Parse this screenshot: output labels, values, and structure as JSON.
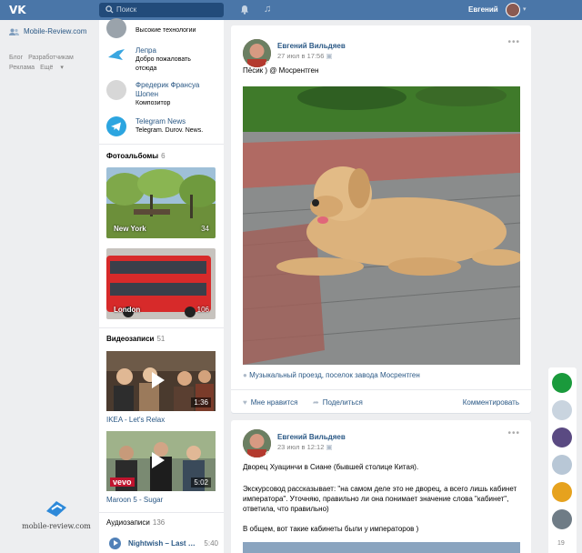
{
  "header": {
    "logo": "VK",
    "search_placeholder": "Поиск",
    "user_name": "Евгений"
  },
  "leftnav": {
    "site_link": "Mobile-Review.com",
    "footer_links": [
      "Блог",
      "Разработчикам",
      "Реклама",
      "Ещё"
    ]
  },
  "watermark": "mobile-review.com",
  "groups": [
    {
      "name": "",
      "desc": "Высокие технологии"
    },
    {
      "name": "Лепра",
      "desc": "Добро пожаловать отсюда"
    },
    {
      "name": "Фредерик Франсуа Шопен",
      "desc": "Композитор"
    },
    {
      "name": "Telegram News",
      "desc": "Telegram. Durov. News."
    }
  ],
  "albums": {
    "title": "Фотоальбомы",
    "count": "6",
    "items": [
      {
        "name": "New York",
        "count": "34"
      },
      {
        "name": "London",
        "count": "106"
      }
    ]
  },
  "videos": {
    "title": "Видеозаписи",
    "count": "51",
    "items": [
      {
        "title": "IKEA - Let's Relax",
        "duration": "1:36"
      },
      {
        "title": "Maroon 5 - Sugar",
        "duration": "5:02",
        "badge": "vevo"
      }
    ]
  },
  "audios": {
    "title": "Аудиозаписи",
    "count": "136",
    "items": [
      {
        "title": "Nightwish – Last …",
        "duration": "5:40"
      }
    ]
  },
  "posts": [
    {
      "author": "Евгений Вильдяев",
      "date": "27 июл в 17:56",
      "text": "Пёсик ) @ Мосрентген",
      "location": "Музыкальный проезд, поселок завода Мосрентген",
      "like_label": "Мне нравится",
      "share_label": "Поделиться",
      "comment_label": "Комментировать"
    },
    {
      "author": "Евгений Вильдяев",
      "date": "23 июл в 12:12",
      "paragraphs": [
        "Дворец Хуацинчи в Сиане (бывшей столице Китая).",
        "Экскурсовод рассказывает: \"на самом деле это не дворец, а всего лишь кабинет императора\". Уточняю, правильно ли она понимает значение слова \"кабинет\", ответила, что правильно)",
        "В общем, вот такие кабинеты были у императоров )"
      ]
    }
  ],
  "rail": {
    "count": "19"
  },
  "colors": {
    "header": "#4a76a8",
    "link": "#2a5885",
    "background": "#edeef0"
  }
}
